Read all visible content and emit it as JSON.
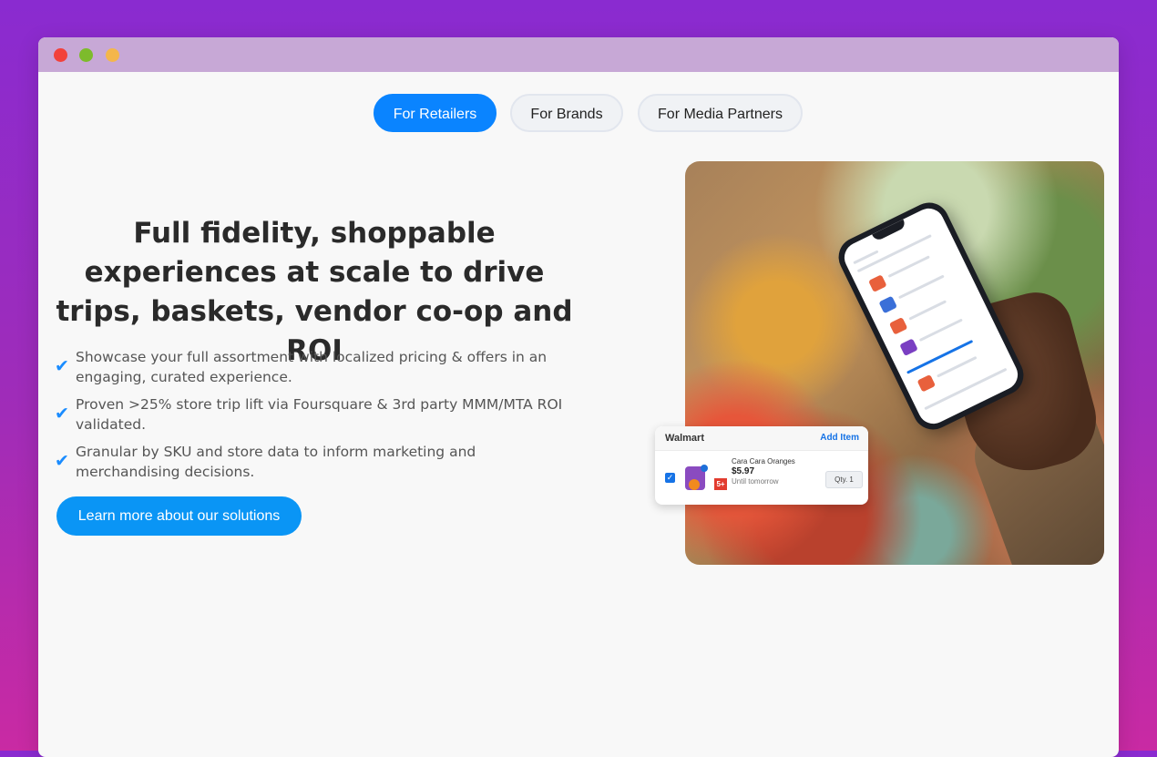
{
  "tabs": [
    {
      "label": "For Retailers",
      "active": true
    },
    {
      "label": "For Brands",
      "active": false
    },
    {
      "label": "For Media Partners",
      "active": false
    }
  ],
  "main": {
    "headline": "Full fidelity, shoppable experiences at scale to drive trips, baskets, vendor co-op and ROI",
    "bullets": [
      "Showcase your full assortment with localized pricing & offers in an engaging, curated experience.",
      "Proven >25% store trip lift via Foursquare & 3rd party MMM/MTA ROI validated.",
      "Granular by SKU and store data to inform marketing and merchandising decisions."
    ],
    "bullet_icon": "check-icon",
    "cta_label": "Learn more about our solutions"
  },
  "card": {
    "store": "Walmart",
    "add_item": "Add Item",
    "item_name": "Cara Cara Oranges",
    "price": "$5.97",
    "until": "Until tomorrow",
    "qty": "Qty. 1",
    "tag": "5+"
  },
  "colors": {
    "accent": "#0a84ff",
    "cta": "#0a95f5",
    "background_top": "#8a2bd0",
    "background_bottom": "#c92aa3"
  }
}
